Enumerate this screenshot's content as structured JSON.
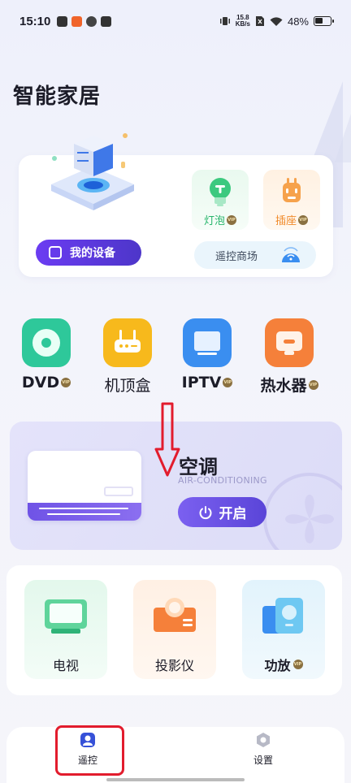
{
  "status_bar": {
    "time": "15:10",
    "net_speed_top": "15.8",
    "net_speed_bottom": "KB/s",
    "battery": "48%"
  },
  "page": {
    "title": "智能家居"
  },
  "device_card": {
    "my_devices_label": "我的设备",
    "tiles": [
      {
        "label": "灯泡",
        "vip": "VIP"
      },
      {
        "label": "插座",
        "vip": "VIP"
      }
    ],
    "store_label": "遥控商场"
  },
  "devices": [
    {
      "label": "DVD",
      "vip": "VIP",
      "color": "#2ec89a"
    },
    {
      "label": "机顶盒",
      "vip": "",
      "color": "#f7b91c"
    },
    {
      "label": "IPTV",
      "vip": "VIP",
      "color": "#3a8ef0"
    },
    {
      "label": "热水器",
      "vip": "VIP",
      "color": "#f5803a"
    }
  ],
  "ac": {
    "title": "空调",
    "subtitle": "AIR-CONDITIONING",
    "power_label": "开启",
    "accent": "#6b52e6"
  },
  "media_devices": [
    {
      "label": "电视",
      "vip": ""
    },
    {
      "label": "投影仪",
      "vip": ""
    },
    {
      "label": "功放",
      "vip": "VIP"
    }
  ],
  "nav": {
    "items": [
      {
        "label": "遥控",
        "icon": "remote-icon",
        "active": true
      },
      {
        "label": "设置",
        "icon": "gear-icon",
        "active": false
      }
    ]
  }
}
